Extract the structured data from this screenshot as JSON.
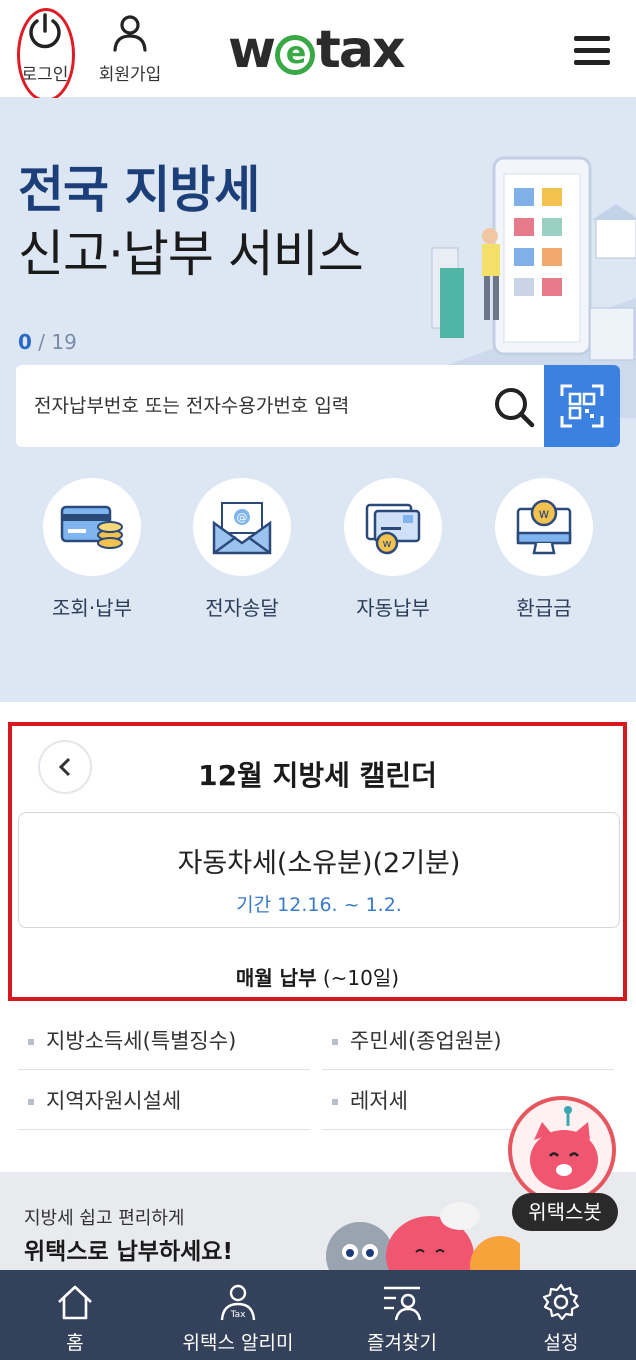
{
  "header": {
    "login_label": "로그인",
    "join_label": "회원가입",
    "logo_w": "w",
    "logo_e": "e",
    "logo_rest": "tax"
  },
  "hero": {
    "title_line1": "전국 지방세",
    "title_line2": "신고·납부 서비스",
    "pager_current": "0",
    "pager_sep": " / ",
    "pager_total": "19"
  },
  "search": {
    "placeholder": "전자납부번호 또는 전자수용가번호 입력"
  },
  "quick_menu": [
    {
      "label": "조회·납부",
      "icon": "card-coins-icon"
    },
    {
      "label": "전자송달",
      "icon": "email-envelope-icon"
    },
    {
      "label": "자동납부",
      "icon": "auto-pay-icon"
    },
    {
      "label": "환급금",
      "icon": "refund-monitor-icon"
    }
  ],
  "calendar": {
    "title": "12월 지방세 캘린더",
    "card_name": "자동차세(소유분)(2기분)",
    "card_period": "기간 12.16. ~ 1.2.",
    "monthly_bold": "매월 납부",
    "monthly_rest": " (~10일)",
    "items": [
      "지방소득세(특별징수)",
      "주민세(종업원분)",
      "지역자원시설세",
      "레저세"
    ]
  },
  "banner": {
    "line1": "지방세 쉽고 편리하게",
    "line2": "위택스로 납부하세요!"
  },
  "chatbot": {
    "label": "위택스봇"
  },
  "bottom_nav": [
    {
      "label": "홈",
      "icon": "home-icon"
    },
    {
      "label": "위택스 알리미",
      "icon": "tax-notifier-icon"
    },
    {
      "label": "즐겨찾기",
      "icon": "favorites-icon"
    },
    {
      "label": "설정",
      "icon": "settings-gear-icon"
    }
  ],
  "colors": {
    "hero_bg": "#dde7f4",
    "brand_green": "#3aa845",
    "primary_blue": "#3b82e0",
    "highlight_red": "#d7191f",
    "nav_bg": "#33415a"
  }
}
